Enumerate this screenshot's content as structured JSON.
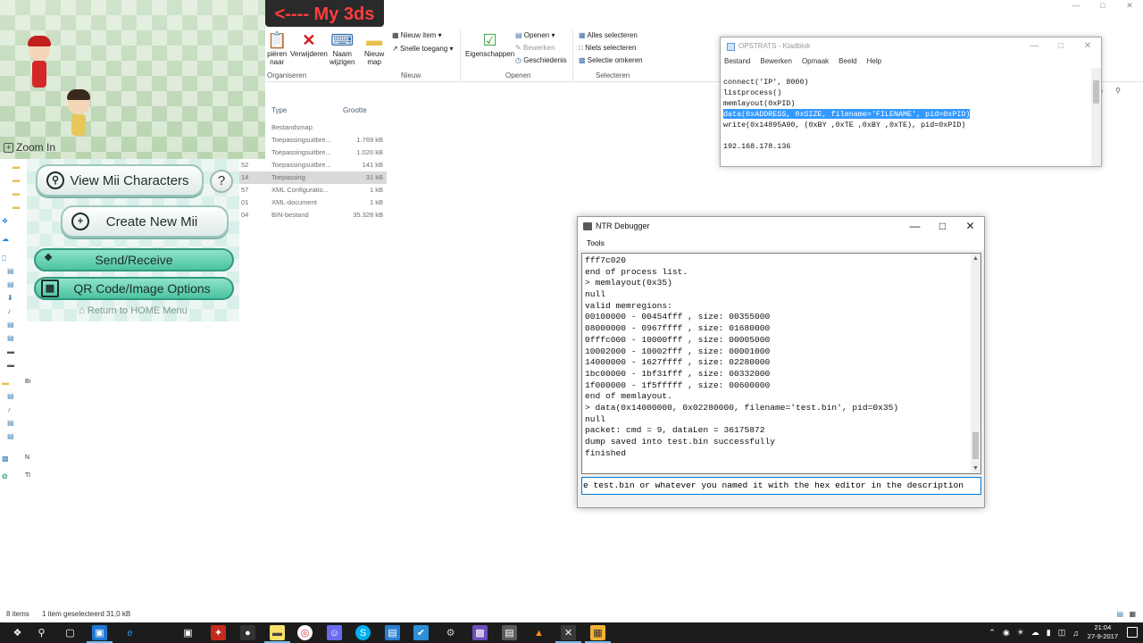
{
  "overlay": {
    "label": "<---- My 3ds",
    "zoom_in": "Zoom In",
    "buttons": {
      "view_mii": "View Mii Characters",
      "help": "?",
      "create_mii": "Create New Mii",
      "send_receive": "Send/Receive",
      "qr_code": "QR Code/Image Options"
    },
    "home_link": "Return to HOME Menu"
  },
  "explorer": {
    "ribbon": {
      "clip1": "piëren",
      "clip2": "naar",
      "delete": "Verwijderen",
      "rename_1": "Naam",
      "rename_2": "wijzigen",
      "new_folder_1": "Nieuw",
      "new_folder_2": "map",
      "new_item": "Nieuw item",
      "easy_access": "Snelle toegang",
      "properties": "Eigenschappen",
      "open": "Openen",
      "edit": "Bewerken",
      "history": "Geschiedenis",
      "select_all": "Alles selecteren",
      "select_none": "Niets selecteren",
      "invert": "Selectie omkeren",
      "groups": {
        "organize": "Organiseren",
        "new": "Nieuw",
        "open": "Openen",
        "select": "Selecteren"
      }
    },
    "search_fragment": "en",
    "columns": {
      "type": "Type",
      "size": "Grootte"
    },
    "files": [
      {
        "name": "",
        "type": "Bestandsmap",
        "size": ""
      },
      {
        "name": "",
        "type": "Toepassingsuitbre...",
        "size": "1.769 kB"
      },
      {
        "name": "",
        "type": "Toepassingsuitbre...",
        "size": "1.020 kB"
      },
      {
        "name": "52",
        "type": "Toepassingsuitbre...",
        "size": "141 kB"
      },
      {
        "name": "14",
        "type": "Toepassing",
        "size": "31 kB"
      },
      {
        "name": "57",
        "type": "XML Configuratio...",
        "size": "1 kB"
      },
      {
        "name": "01",
        "type": "XML-document",
        "size": "1 kB"
      },
      {
        "name": "04",
        "type": "BIN-bestand",
        "size": "35.328 kB"
      }
    ],
    "nav_labels": [
      "N",
      "Tl",
      "Bi"
    ],
    "status": {
      "items": "8 items",
      "selected": "1 item geselecteerd  31,0 kB"
    }
  },
  "notepad": {
    "title": "OPSTRATS - Kladblok",
    "menu": [
      "Bestand",
      "Bewerken",
      "Opmaak",
      "Beeld",
      "Help"
    ],
    "lines": [
      "connect('IP', 8000)",
      "listprocess()",
      "memlayout(0xPID)",
      "data(0xADDRESS, 0xSIZE, filename='FILENAME', pid=0xPID)",
      "write(0x14895A90, (0xBY ,0xTE ,0xBY ,0xTE), pid=0xPID)",
      "",
      "192.168.178.136"
    ]
  },
  "ntr": {
    "title": "NTR Debugger",
    "menu": "Tools",
    "output": [
      "fff7c020",
      "end of process list.",
      "> memlayout(0x35)",
      "null",
      "valid memregions:",
      "00100000 - 00454fff , size: 00355000",
      "08000000 - 0967ffff , size: 01680000",
      "0fffc000 - 10000fff , size: 00005000",
      "10002000 - 10002fff , size: 00001000",
      "14000000 - 1627ffff , size: 02280000",
      "1bc00000 - 1bf31fff , size: 00332000",
      "1f000000 - 1f5fffff , size: 00600000",
      "end of memlayout.",
      "> data(0x14000000, 0x02280000, filename='test.bin', pid=0x35)",
      "null",
      "packet: cmd = 9, dataLen = 36175872",
      "dump saved into test.bin successfully",
      "finished"
    ],
    "command": "e test.bin or whatever you named it with the hex editor in the description"
  },
  "taskbar": {
    "time": "21:04",
    "date": "27-9-2017"
  }
}
